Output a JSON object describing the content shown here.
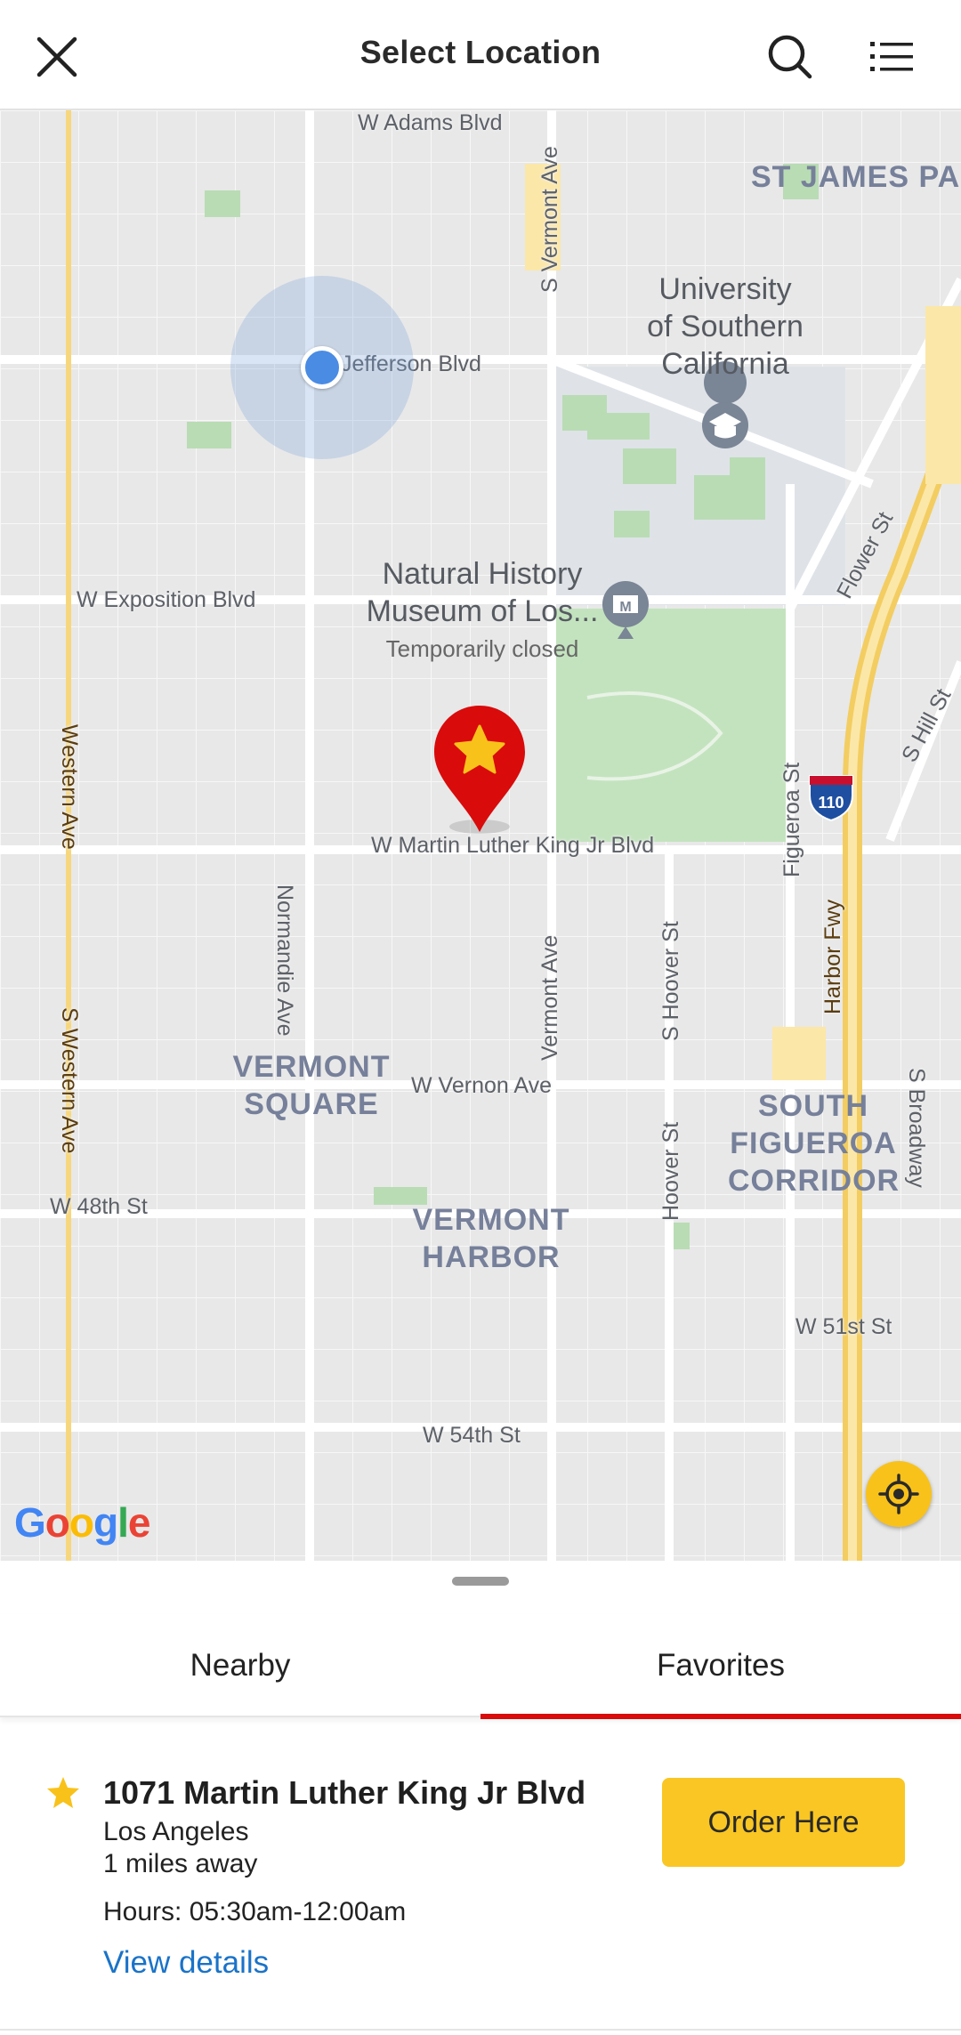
{
  "header": {
    "title": "Select Location",
    "close_icon": "close-icon",
    "search_icon": "search-icon",
    "list_icon": "list-icon"
  },
  "map": {
    "streets": {
      "adams": "W Adams Blvd",
      "jefferson": "Jefferson Blvd",
      "exposition": "W Exposition Blvd",
      "mlk": "W Martin Luther King Jr Blvd",
      "vernon": "W Vernon Ave",
      "w48": "W 48th St",
      "w51": "W 51st St",
      "w54": "W 54th St",
      "s_vermont": "S Vermont Ave",
      "vermont": "Vermont Ave",
      "normandie": "Normandie Ave",
      "western": "Western Ave",
      "s_western": "S Western Ave",
      "s_hoover": "S Hoover St",
      "hoover": "Hoover St",
      "figueroa": "Figueroa St",
      "harbor_fwy": "Harbor Fwy",
      "flower": "Flower St",
      "s_hill": "S Hill St",
      "s_broadway": "S Broadway"
    },
    "neighborhoods": {
      "st_james": "ST JAMES PARK",
      "vermont_square_1": "VERMONT",
      "vermont_square_2": "SQUARE",
      "vermont_harbor_1": "VERMONT",
      "vermont_harbor_2": "HARBOR",
      "south_fig_1": "SOUTH",
      "south_fig_2": "FIGUEROA",
      "south_fig_3": "CORRIDOR"
    },
    "pois": {
      "usc_1": "University",
      "usc_2": "of Southern",
      "usc_3": "California",
      "nhm_1": "Natural History",
      "nhm_2": "Museum of Los...",
      "nhm_status": "Temporarily closed"
    },
    "highway_shield": "110",
    "google_letters": [
      "G",
      "o",
      "o",
      "g",
      "l",
      "e"
    ],
    "locate_icon": "crosshair-icon",
    "pin_icon": "favorite-pin-icon"
  },
  "tabs": [
    {
      "label": "Nearby",
      "active": false
    },
    {
      "label": "Favorites",
      "active": true
    }
  ],
  "location": {
    "name": "1071 Martin Luther King Jr Blvd",
    "city": "Los Angeles",
    "distance": "1 miles away",
    "hours": "Hours: 05:30am-12:00am",
    "details_link": "View details",
    "order_button": "Order Here",
    "favorite_icon": "star-icon"
  },
  "colors": {
    "accent_yellow": "#f9c623",
    "tab_underline": "#d90b0b",
    "link_blue": "#1a73c8",
    "pin_red": "#d90b0b"
  }
}
